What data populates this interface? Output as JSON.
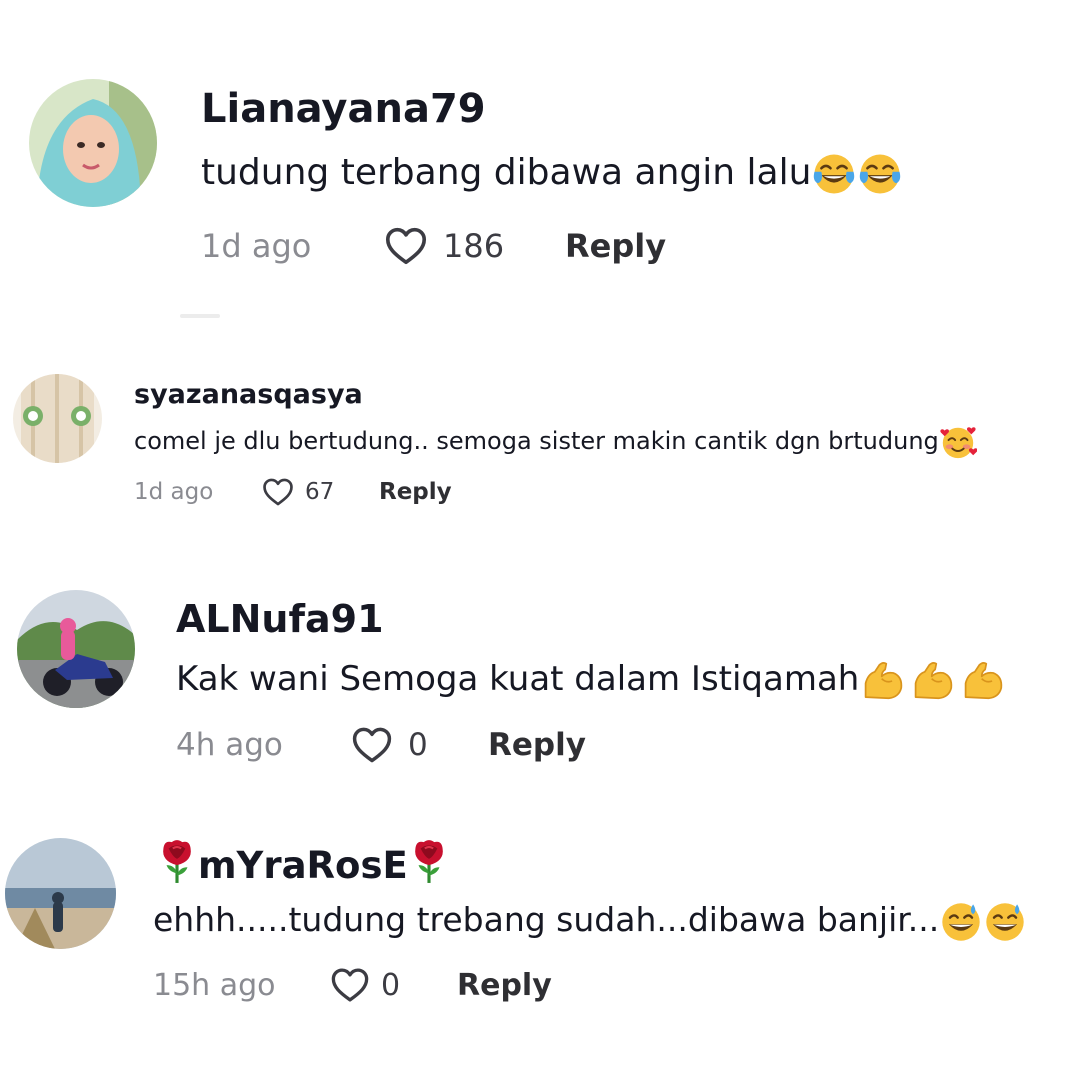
{
  "comments": [
    {
      "username": "Lianayana79",
      "text": "tudung terbang dibawa angin lalu",
      "emojis": [
        "tears-of-joy-icon",
        "tears-of-joy-icon"
      ],
      "time": "1d ago",
      "likes": "186",
      "reply_label": "Reply"
    },
    {
      "username": "syazanasqasya",
      "text": "comel je dlu bertudung.. semoga sister makin cantik dgn brtudung",
      "emojis": [
        "smiling-face-with-hearts-icon"
      ],
      "time": "1d ago",
      "likes": "67",
      "reply_label": "Reply"
    },
    {
      "username": "ALNufa91",
      "text": "Kak wani Semoga kuat dalam Istiqamah",
      "emojis": [
        "flexed-biceps-icon",
        "flexed-biceps-icon",
        "flexed-biceps-icon"
      ],
      "time": "4h ago",
      "likes": "0",
      "reply_label": "Reply"
    },
    {
      "username": "mYraRosE",
      "username_decor": [
        "rose-icon",
        "rose-icon"
      ],
      "text": "ehhh.....tudung trebang sudah...dibawa banjir...",
      "emojis": [
        "grinning-sweat-icon",
        "grinning-sweat-icon"
      ],
      "time": "15h ago",
      "likes": "0",
      "reply_label": "Reply"
    }
  ],
  "colors": {
    "text": "#161823",
    "muted": "#8a8b91",
    "emoji_yellow": "#f8c13a",
    "rose_red": "#c8102e"
  }
}
